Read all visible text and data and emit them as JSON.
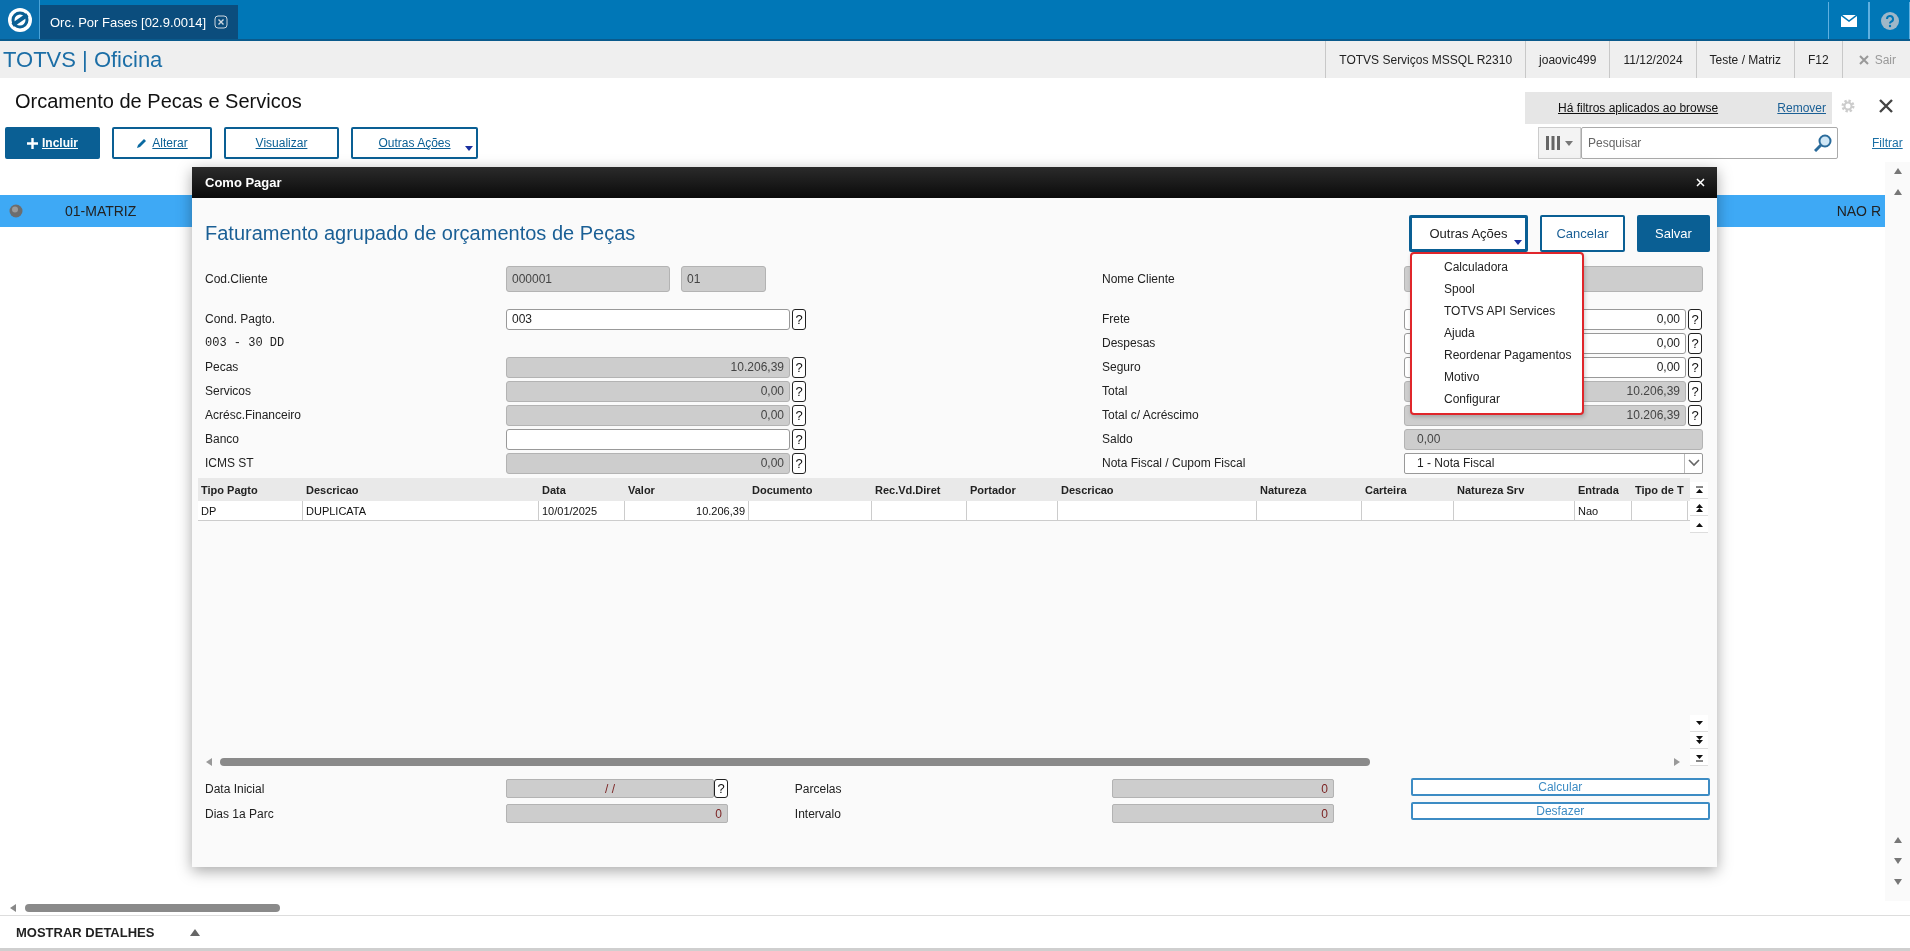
{
  "app_tabs": [
    {
      "label": "Orc. Por Fases [02.9.0014]",
      "selected": true
    }
  ],
  "header": {
    "title": "TOTVS | Oficina",
    "info": [
      "TOTVS Serviços MSSQL R2310",
      "joaovic499",
      "11/12/2024",
      "Teste / Matriz",
      "F12"
    ],
    "exit": "Sair"
  },
  "page": {
    "title": "Orcamento de Pecas e Servicos",
    "actions": [
      {
        "label": "Incluir",
        "kind": "primary"
      },
      {
        "label": "Alterar",
        "kind": "edit"
      },
      {
        "label": "Visualizar",
        "kind": "plain"
      },
      {
        "label": "Outras Ações",
        "kind": "menu"
      }
    ],
    "filter_notice": "Há filtros aplicados ao browse",
    "filter_remove": "Remover",
    "search": {
      "placeholder": "Pesquisar"
    },
    "filter_link": "Filtrar"
  },
  "browse": {
    "rows": [
      {
        "cells": [
          "01-MATRIZ",
          "NAO R"
        ],
        "selected": true
      }
    ]
  },
  "dialog": {
    "title": "Como Pagar",
    "heading": "Faturamento agrupado de orçamentos de Peças",
    "buttons": [
      {
        "label": "Outras Ações",
        "kind": "menu",
        "expanded": true
      },
      {
        "label": "Cancelar",
        "kind": "secondary"
      },
      {
        "label": "Salvar",
        "kind": "primary"
      }
    ],
    "menu": [
      "Calculadora",
      "Spool",
      "TOTVS API Services",
      "Ajuda",
      "Reordenar Pagamentos",
      "Motivo",
      "Configurar"
    ],
    "left_fields": [
      {
        "kind": "pair",
        "label": "Cod.Cliente",
        "values": [
          "000001",
          "01"
        ],
        "disabled": true
      },
      {
        "kind": "text",
        "label": "Cond. Pagto.",
        "value": "003",
        "disabled": false,
        "help": "?"
      },
      {
        "kind": "note",
        "label": "003 - 30 DD"
      },
      {
        "kind": "number",
        "label": "Pecas",
        "value": "10.206,39",
        "disabled": true,
        "help": "?"
      },
      {
        "kind": "number",
        "label": "Servicos",
        "value": "0,00",
        "disabled": true,
        "help": "?"
      },
      {
        "kind": "number",
        "label": "Acrésc.Financeiro",
        "value": "0,00",
        "disabled": true,
        "help": "?"
      },
      {
        "kind": "text",
        "label": "Banco",
        "disabled": false,
        "help": "?"
      },
      {
        "kind": "number",
        "label": "ICMS ST",
        "value": "0,00",
        "disabled": true,
        "help": "?"
      }
    ],
    "right_fields": [
      {
        "kind": "text",
        "label": "Nome Cliente",
        "disabled": true
      },
      {
        "kind": "number",
        "label": "Frete",
        "value": "0,00",
        "disabled": false,
        "help": "?"
      },
      {
        "kind": "number",
        "label": "Despesas",
        "value": "0,00",
        "disabled": false,
        "help": "?"
      },
      {
        "kind": "number",
        "label": "Seguro",
        "value": "0,00",
        "disabled": false,
        "help": "?"
      },
      {
        "kind": "number",
        "label": "Total",
        "value": "10.206,39",
        "disabled": true,
        "help": "?"
      },
      {
        "kind": "number",
        "label": "Total c/ Acréscimo",
        "value": "10.206,39",
        "disabled": true,
        "help": "?"
      },
      {
        "kind": "text",
        "label": "Saldo",
        "value": "0,00",
        "disabled": true
      },
      {
        "kind": "select",
        "label": "Nota Fiscal / Cupom Fiscal",
        "value": "1 - Nota Fiscal"
      }
    ],
    "grid": {
      "columns": [
        "Tipo Pagto",
        "Descricao",
        "Data",
        "Valor",
        "Documento",
        "Rec.Vd.Diret",
        "Portador",
        "Descricao",
        "Natureza",
        "Carteira",
        "Natureza Srv",
        "Entrada",
        "Tipo de T"
      ],
      "rows": [
        {
          "cells": [
            "DP",
            "DUPLICATA",
            "10/01/2025",
            "10.206,39",
            null,
            null,
            null,
            null,
            null,
            null,
            null,
            "Nao",
            null
          ]
        }
      ]
    },
    "bottom_left": [
      {
        "kind": "date",
        "label": "Data Inicial",
        "value": "/ /",
        "help": "?"
      },
      {
        "kind": "number",
        "label": "Dias 1a Parc",
        "value": "0"
      }
    ],
    "bottom_middle": [
      {
        "kind": "number",
        "label": "Parcelas",
        "value": "0"
      },
      {
        "kind": "number",
        "label": "Intervalo",
        "value": "0"
      }
    ],
    "bottom_buttons": [
      "Calcular",
      "Desfazer"
    ]
  },
  "footer": {
    "details": "MOSTRAR DETALHES"
  }
}
